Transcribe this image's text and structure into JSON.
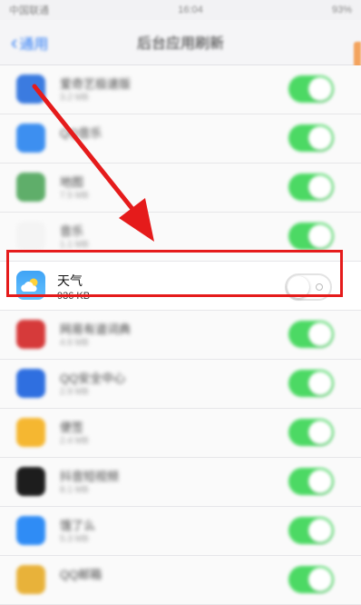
{
  "status_bar": {
    "time": "16:04",
    "carrier": "中国联通",
    "battery": "93%"
  },
  "nav": {
    "back_label": "通用",
    "title": "后台应用刷新"
  },
  "rows": [
    {
      "name": "爱奇艺极速版",
      "size": "3.2 MB",
      "icon": "app-icon-blue",
      "color": "#3b7be0",
      "enabled": true
    },
    {
      "name": "QQ音乐",
      "size": "",
      "icon": "app-icon-blue",
      "color": "#3d8ff0",
      "enabled": true
    },
    {
      "name": "地图",
      "size": "7.5 MB",
      "icon": "maps-icon",
      "color": "#5fae6a",
      "enabled": true
    },
    {
      "name": "音乐",
      "size": "1.1 MB",
      "icon": "music-icon",
      "color": "#f4f4f4",
      "enabled": true
    },
    {
      "name": "天气",
      "size": "936 KB",
      "icon": "weather-icon",
      "color": "#3fa3f5",
      "enabled": false
    },
    {
      "name": "网易有道词典",
      "size": "4.6 MB",
      "icon": "app-icon-red",
      "color": "#d63a3a",
      "enabled": true
    },
    {
      "name": "QQ安全中心",
      "size": "2.9 MB",
      "icon": "shield-icon",
      "color": "#2f6fe0",
      "enabled": true
    },
    {
      "name": "便签",
      "size": "2.4 MB",
      "icon": "app-icon-yellow",
      "color": "#f5b731",
      "enabled": true
    },
    {
      "name": "抖音短视频",
      "size": "8.1 MB",
      "icon": "app-icon-black",
      "color": "#1d1d1d",
      "enabled": true
    },
    {
      "name": "饿了么",
      "size": "5.3 MB",
      "icon": "app-icon-blue",
      "color": "#2f8cf5",
      "enabled": true
    },
    {
      "name": "QQ邮箱",
      "size": "",
      "icon": "app-icon-yellow",
      "color": "#e8b23a",
      "enabled": true
    }
  ],
  "annotation": {
    "arrow_color": "#e51b1b",
    "box_color": "#e51b1b"
  }
}
